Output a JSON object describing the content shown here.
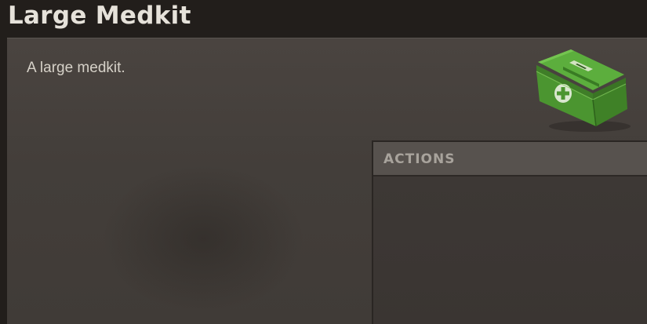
{
  "item": {
    "title": "Large Medkit",
    "description": "A large medkit.",
    "icon": "green-medkit-box-icon"
  },
  "actions": {
    "header": "ACTIONS",
    "items": []
  },
  "colors": {
    "title": "#e6e2da",
    "panel": "#464039",
    "actions_header": "#57524e",
    "medkit_green": "#4f9a35"
  }
}
